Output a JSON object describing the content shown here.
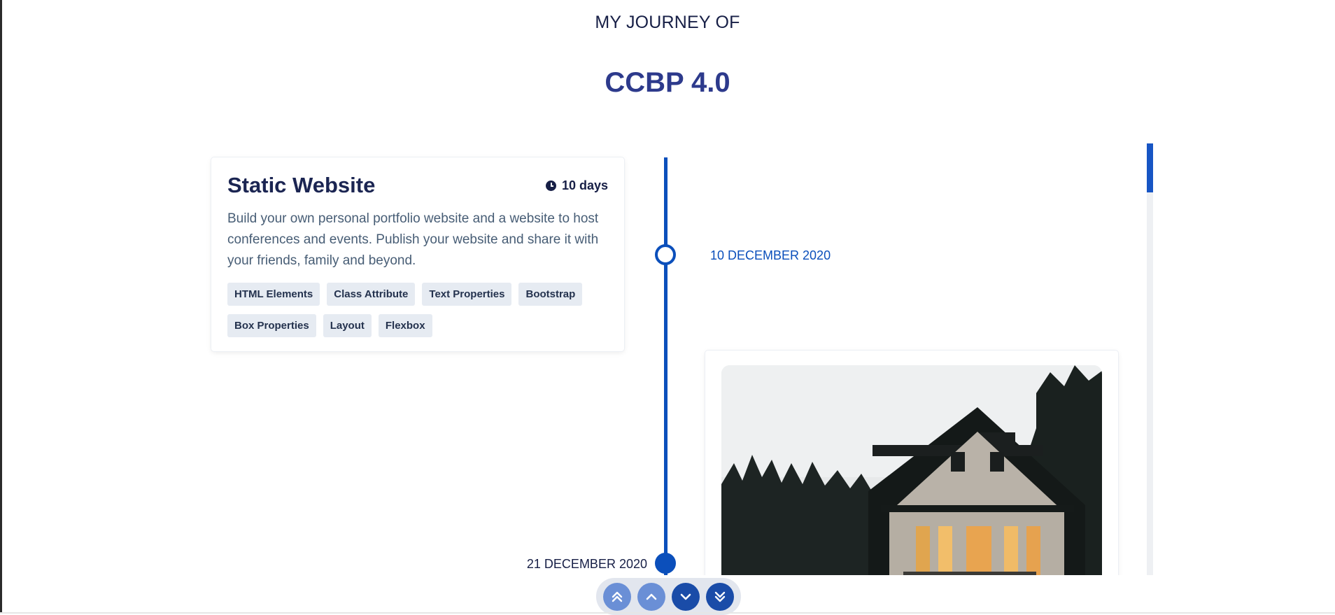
{
  "header": {
    "subtitle": "MY JOURNEY OF",
    "title": "CCBP 4.0"
  },
  "timeline": {
    "date_1": "10 DECEMBER 2020",
    "date_2": "21 DECEMBER 2020"
  },
  "course_card": {
    "title": "Static Website",
    "duration": "10 days",
    "description": "Build your own personal portfolio website and a website to host conferences and events. Publish your website and share it with your friends, family and beyond.",
    "tags": [
      "HTML Elements",
      "Class Attribute",
      "Text Properties",
      "Bootstrap",
      "Box Properties",
      "Layout",
      "Flexbox"
    ]
  },
  "image_card": {
    "icon": "house-photo"
  },
  "scroll_controls": [
    {
      "name": "scroll-top-button",
      "icon": "double-chevron-up-icon"
    },
    {
      "name": "scroll-up-button",
      "icon": "chevron-up-icon"
    },
    {
      "name": "scroll-down-button",
      "icon": "chevron-down-icon"
    },
    {
      "name": "scroll-bottom-button",
      "icon": "double-chevron-down-icon"
    }
  ],
  "colors": {
    "accent": "#0b4fbb",
    "title": "#2d3a8c",
    "tag_bg": "#e6ebf2"
  }
}
